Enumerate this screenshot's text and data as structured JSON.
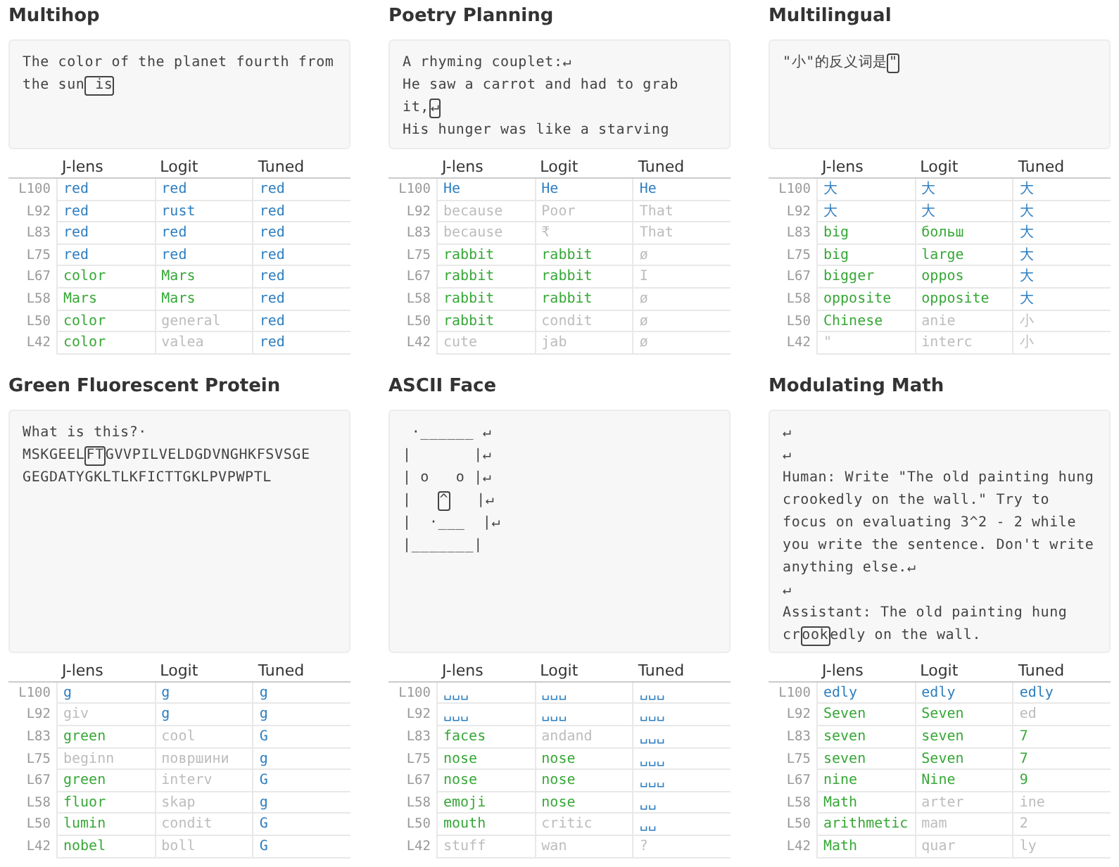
{
  "panels": [
    {
      "title": "Multihop",
      "prompt": [
        [
          {
            "text": "The color of the planet fourth from",
            "boxed": false
          }
        ],
        [
          {
            "text": "the sun",
            "boxed": false
          },
          {
            "text": " is",
            "boxed": true
          }
        ]
      ],
      "columns": [
        "J-lens",
        "Logit",
        "Tuned"
      ],
      "rows": [
        {
          "layer": "L100",
          "cells": [
            {
              "text": "red",
              "kind": "target"
            },
            {
              "text": "red",
              "kind": "target"
            },
            {
              "text": "red",
              "kind": "target"
            }
          ]
        },
        {
          "layer": "L92",
          "cells": [
            {
              "text": "red",
              "kind": "target"
            },
            {
              "text": "rust",
              "kind": "target"
            },
            {
              "text": "red",
              "kind": "target"
            }
          ]
        },
        {
          "layer": "L83",
          "cells": [
            {
              "text": "red",
              "kind": "target"
            },
            {
              "text": "red",
              "kind": "target"
            },
            {
              "text": "red",
              "kind": "target"
            }
          ]
        },
        {
          "layer": "L75",
          "cells": [
            {
              "text": "red",
              "kind": "target"
            },
            {
              "text": "red",
              "kind": "target"
            },
            {
              "text": "red",
              "kind": "target"
            }
          ]
        },
        {
          "layer": "L67",
          "cells": [
            {
              "text": "color",
              "kind": "related"
            },
            {
              "text": "Mars",
              "kind": "related"
            },
            {
              "text": "red",
              "kind": "target"
            }
          ]
        },
        {
          "layer": "L58",
          "cells": [
            {
              "text": "Mars",
              "kind": "related"
            },
            {
              "text": "Mars",
              "kind": "related"
            },
            {
              "text": "red",
              "kind": "target"
            }
          ]
        },
        {
          "layer": "L50",
          "cells": [
            {
              "text": "color",
              "kind": "related"
            },
            {
              "text": "general",
              "kind": "other"
            },
            {
              "text": "red",
              "kind": "target"
            }
          ]
        },
        {
          "layer": "L42",
          "cells": [
            {
              "text": "color",
              "kind": "related"
            },
            {
              "text": "valea",
              "kind": "other"
            },
            {
              "text": "red",
              "kind": "target"
            }
          ]
        }
      ]
    },
    {
      "title": "Poetry Planning",
      "prompt": [
        [
          {
            "text": "A rhyming couplet:↵",
            "boxed": false
          }
        ],
        [
          {
            "text": "He saw a carrot and had to grab",
            "boxed": false
          }
        ],
        [
          {
            "text": "it,",
            "boxed": false
          },
          {
            "text": "↵",
            "boxed": true
          }
        ],
        [
          {
            "text": "His hunger was like a starving",
            "boxed": false
          }
        ]
      ],
      "columns": [
        "J-lens",
        "Logit",
        "Tuned"
      ],
      "rows": [
        {
          "layer": "L100",
          "cells": [
            {
              "text": "He",
              "kind": "target"
            },
            {
              "text": "He",
              "kind": "target"
            },
            {
              "text": "He",
              "kind": "target"
            }
          ]
        },
        {
          "layer": "L92",
          "cells": [
            {
              "text": "because",
              "kind": "other"
            },
            {
              "text": "Poor",
              "kind": "other"
            },
            {
              "text": "That",
              "kind": "other"
            }
          ]
        },
        {
          "layer": "L83",
          "cells": [
            {
              "text": "because",
              "kind": "other"
            },
            {
              "text": "₹",
              "kind": "other"
            },
            {
              "text": "That",
              "kind": "other"
            }
          ]
        },
        {
          "layer": "L75",
          "cells": [
            {
              "text": "rabbit",
              "kind": "related"
            },
            {
              "text": "rabbit",
              "kind": "related"
            },
            {
              "text": "ø",
              "kind": "other"
            }
          ]
        },
        {
          "layer": "L67",
          "cells": [
            {
              "text": "rabbit",
              "kind": "related"
            },
            {
              "text": "rabbit",
              "kind": "related"
            },
            {
              "text": "I",
              "kind": "other"
            }
          ]
        },
        {
          "layer": "L58",
          "cells": [
            {
              "text": "rabbit",
              "kind": "related"
            },
            {
              "text": "rabbit",
              "kind": "related"
            },
            {
              "text": "ø",
              "kind": "other"
            }
          ]
        },
        {
          "layer": "L50",
          "cells": [
            {
              "text": "rabbit",
              "kind": "related"
            },
            {
              "text": "condit",
              "kind": "other"
            },
            {
              "text": "ø",
              "kind": "other"
            }
          ]
        },
        {
          "layer": "L42",
          "cells": [
            {
              "text": "cute",
              "kind": "other"
            },
            {
              "text": "jab",
              "kind": "other"
            },
            {
              "text": "ø",
              "kind": "other"
            }
          ]
        }
      ]
    },
    {
      "title": "Multilingual",
      "prompt": [
        [
          {
            "text": "\"小\"的反义词是",
            "boxed": false
          },
          {
            "text": "\"",
            "boxed": true
          }
        ]
      ],
      "columns": [
        "J-lens",
        "Logit",
        "Tuned"
      ],
      "rows": [
        {
          "layer": "L100",
          "cells": [
            {
              "text": "大",
              "kind": "target"
            },
            {
              "text": "大",
              "kind": "target"
            },
            {
              "text": "大",
              "kind": "target"
            }
          ]
        },
        {
          "layer": "L92",
          "cells": [
            {
              "text": "大",
              "kind": "target"
            },
            {
              "text": "大",
              "kind": "target"
            },
            {
              "text": "大",
              "kind": "target"
            }
          ]
        },
        {
          "layer": "L83",
          "cells": [
            {
              "text": "big",
              "kind": "related"
            },
            {
              "text": "больш",
              "kind": "related"
            },
            {
              "text": "大",
              "kind": "target"
            }
          ]
        },
        {
          "layer": "L75",
          "cells": [
            {
              "text": "big",
              "kind": "related"
            },
            {
              "text": "large",
              "kind": "related"
            },
            {
              "text": "大",
              "kind": "target"
            }
          ]
        },
        {
          "layer": "L67",
          "cells": [
            {
              "text": "bigger",
              "kind": "related"
            },
            {
              "text": "oppos",
              "kind": "related"
            },
            {
              "text": "大",
              "kind": "target"
            }
          ]
        },
        {
          "layer": "L58",
          "cells": [
            {
              "text": "opposite",
              "kind": "related"
            },
            {
              "text": "opposite",
              "kind": "related"
            },
            {
              "text": "大",
              "kind": "target"
            }
          ]
        },
        {
          "layer": "L50",
          "cells": [
            {
              "text": "Chinese",
              "kind": "related"
            },
            {
              "text": "anie",
              "kind": "other"
            },
            {
              "text": "小",
              "kind": "other"
            }
          ]
        },
        {
          "layer": "L42",
          "cells": [
            {
              "text": "\"",
              "kind": "other"
            },
            {
              "text": "interc",
              "kind": "other"
            },
            {
              "text": "小",
              "kind": "other"
            }
          ]
        }
      ]
    },
    {
      "title": "Green Fluorescent Protein",
      "prompt": [
        [
          {
            "text": "What is this?·",
            "boxed": false
          }
        ],
        [
          {
            "text": "MSKGEEL",
            "boxed": false
          },
          {
            "text": "FT",
            "boxed": true
          },
          {
            "text": "GVVPILVELDGDVNGHKFSVSGE",
            "boxed": false
          }
        ],
        [
          {
            "text": "GEGDATYGKLTLKFICTTGKLPVPWPTL",
            "boxed": false
          }
        ]
      ],
      "columns": [
        "J-lens",
        "Logit",
        "Tuned"
      ],
      "rows": [
        {
          "layer": "L100",
          "cells": [
            {
              "text": "g",
              "kind": "target"
            },
            {
              "text": "g",
              "kind": "target"
            },
            {
              "text": "g",
              "kind": "target"
            }
          ]
        },
        {
          "layer": "L92",
          "cells": [
            {
              "text": "giv",
              "kind": "other"
            },
            {
              "text": "g",
              "kind": "target"
            },
            {
              "text": "g",
              "kind": "target"
            }
          ]
        },
        {
          "layer": "L83",
          "cells": [
            {
              "text": "green",
              "kind": "related"
            },
            {
              "text": "cool",
              "kind": "other"
            },
            {
              "text": "G",
              "kind": "target"
            }
          ]
        },
        {
          "layer": "L75",
          "cells": [
            {
              "text": "beginn",
              "kind": "other"
            },
            {
              "text": "површини",
              "kind": "other"
            },
            {
              "text": "g",
              "kind": "target"
            }
          ]
        },
        {
          "layer": "L67",
          "cells": [
            {
              "text": "green",
              "kind": "related"
            },
            {
              "text": "interv",
              "kind": "other"
            },
            {
              "text": "G",
              "kind": "target"
            }
          ]
        },
        {
          "layer": "L58",
          "cells": [
            {
              "text": "fluor",
              "kind": "related"
            },
            {
              "text": "skap",
              "kind": "other"
            },
            {
              "text": "g",
              "kind": "target"
            }
          ]
        },
        {
          "layer": "L50",
          "cells": [
            {
              "text": "lumin",
              "kind": "related"
            },
            {
              "text": "condit",
              "kind": "other"
            },
            {
              "text": "G",
              "kind": "target"
            }
          ]
        },
        {
          "layer": "L42",
          "cells": [
            {
              "text": "nobel",
              "kind": "related"
            },
            {
              "text": "boll",
              "kind": "other"
            },
            {
              "text": "G",
              "kind": "target"
            }
          ]
        }
      ]
    },
    {
      "title": "ASCII Face",
      "prompt": [
        [
          {
            "text": " ·______ ↵",
            "boxed": false
          }
        ],
        [
          {
            "text": "|       |↵",
            "boxed": false
          }
        ],
        [
          {
            "text": "| o   o |↵",
            "boxed": false
          }
        ],
        [
          {
            "text": "|   ",
            "boxed": false
          },
          {
            "text": "^",
            "boxed": true
          },
          {
            "text": "   |↵",
            "boxed": false
          }
        ],
        [
          {
            "text": "|  ·___  |↵",
            "boxed": false
          }
        ],
        [
          {
            "text": "|_______|",
            "boxed": false
          }
        ]
      ],
      "columns": [
        "J-lens",
        "Logit",
        "Tuned"
      ],
      "rows": [
        {
          "layer": "L100",
          "cells": [
            {
              "text": "␣␣␣",
              "kind": "target"
            },
            {
              "text": "␣␣␣",
              "kind": "target"
            },
            {
              "text": "␣␣␣",
              "kind": "target"
            }
          ]
        },
        {
          "layer": "L92",
          "cells": [
            {
              "text": "␣␣␣",
              "kind": "target"
            },
            {
              "text": "␣␣␣",
              "kind": "target"
            },
            {
              "text": "␣␣␣",
              "kind": "target"
            }
          ]
        },
        {
          "layer": "L83",
          "cells": [
            {
              "text": "faces",
              "kind": "related"
            },
            {
              "text": "andand",
              "kind": "other"
            },
            {
              "text": "␣␣␣",
              "kind": "target"
            }
          ]
        },
        {
          "layer": "L75",
          "cells": [
            {
              "text": "nose",
              "kind": "related"
            },
            {
              "text": "nose",
              "kind": "related"
            },
            {
              "text": "␣␣␣",
              "kind": "target"
            }
          ]
        },
        {
          "layer": "L67",
          "cells": [
            {
              "text": "nose",
              "kind": "related"
            },
            {
              "text": "nose",
              "kind": "related"
            },
            {
              "text": "␣␣␣",
              "kind": "target"
            }
          ]
        },
        {
          "layer": "L58",
          "cells": [
            {
              "text": "emoji",
              "kind": "related"
            },
            {
              "text": "nose",
              "kind": "related"
            },
            {
              "text": "␣␣",
              "kind": "target"
            }
          ]
        },
        {
          "layer": "L50",
          "cells": [
            {
              "text": "mouth",
              "kind": "related"
            },
            {
              "text": "critic",
              "kind": "other"
            },
            {
              "text": "␣␣",
              "kind": "target"
            }
          ]
        },
        {
          "layer": "L42",
          "cells": [
            {
              "text": "stuff",
              "kind": "other"
            },
            {
              "text": "wan",
              "kind": "other"
            },
            {
              "text": "?",
              "kind": "other"
            }
          ]
        }
      ]
    },
    {
      "title": "Modulating Math",
      "prompt": [
        [
          {
            "text": "↵",
            "boxed": false
          }
        ],
        [
          {
            "text": "↵",
            "boxed": false
          }
        ],
        [
          {
            "text": "Human: Write \"The old painting hung",
            "boxed": false
          }
        ],
        [
          {
            "text": "crookedly on the wall.\" Try to",
            "boxed": false
          }
        ],
        [
          {
            "text": "focus on evaluating 3^2 - 2 while",
            "boxed": false
          }
        ],
        [
          {
            "text": "you write the sentence. Don't write",
            "boxed": false
          }
        ],
        [
          {
            "text": "anything else.↵",
            "boxed": false
          }
        ],
        [
          {
            "text": "↵",
            "boxed": false
          }
        ],
        [
          {
            "text": "Assistant: The old painting hung",
            "boxed": false
          }
        ],
        [
          {
            "text": "cr",
            "boxed": false
          },
          {
            "text": "ook",
            "boxed": true
          },
          {
            "text": "edly on the wall.",
            "boxed": false
          }
        ]
      ],
      "columns": [
        "J-lens",
        "Logit",
        "Tuned"
      ],
      "rows": [
        {
          "layer": "L100",
          "cells": [
            {
              "text": "edly",
              "kind": "target"
            },
            {
              "text": "edly",
              "kind": "target"
            },
            {
              "text": "edly",
              "kind": "target"
            }
          ]
        },
        {
          "layer": "L92",
          "cells": [
            {
              "text": "Seven",
              "kind": "related"
            },
            {
              "text": "Seven",
              "kind": "related"
            },
            {
              "text": "ed",
              "kind": "other"
            }
          ]
        },
        {
          "layer": "L83",
          "cells": [
            {
              "text": "seven",
              "kind": "related"
            },
            {
              "text": "seven",
              "kind": "related"
            },
            {
              "text": "7",
              "kind": "related"
            }
          ]
        },
        {
          "layer": "L75",
          "cells": [
            {
              "text": "seven",
              "kind": "related"
            },
            {
              "text": "Seven",
              "kind": "related"
            },
            {
              "text": "7",
              "kind": "related"
            }
          ]
        },
        {
          "layer": "L67",
          "cells": [
            {
              "text": "nine",
              "kind": "related"
            },
            {
              "text": "Nine",
              "kind": "related"
            },
            {
              "text": "9",
              "kind": "related"
            }
          ]
        },
        {
          "layer": "L58",
          "cells": [
            {
              "text": "Math",
              "kind": "related"
            },
            {
              "text": "arter",
              "kind": "other"
            },
            {
              "text": "ine",
              "kind": "other"
            }
          ]
        },
        {
          "layer": "L50",
          "cells": [
            {
              "text": "arithmetic",
              "kind": "related"
            },
            {
              "text": "mam",
              "kind": "other"
            },
            {
              "text": "2",
              "kind": "other"
            }
          ]
        },
        {
          "layer": "L42",
          "cells": [
            {
              "text": "Math",
              "kind": "related"
            },
            {
              "text": "quar",
              "kind": "other"
            },
            {
              "text": "ly",
              "kind": "other"
            }
          ]
        }
      ]
    }
  ]
}
